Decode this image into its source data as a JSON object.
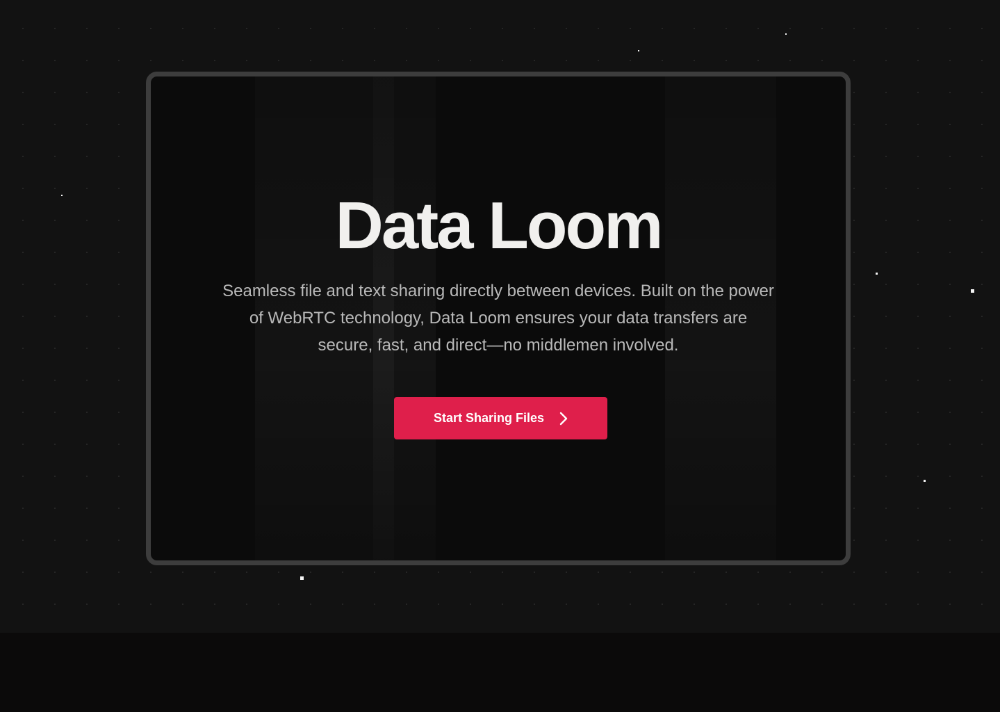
{
  "hero": {
    "title": "Data Loom",
    "description": "Seamless file and text sharing directly between devices. Built on the power of WebRTC technology, Data Loom ensures your data transfers are secure, fast, and direct—no middlemen involved.",
    "cta_label": "Start Sharing Files",
    "cta_icon": "chevron-right-icon"
  },
  "colors": {
    "background": "#121212",
    "card_border": "#3d3d3d",
    "card_background": "#0b0b0b",
    "title": "#f1f0ee",
    "description": "#b9b9b9",
    "accent": "#df1f4b"
  }
}
